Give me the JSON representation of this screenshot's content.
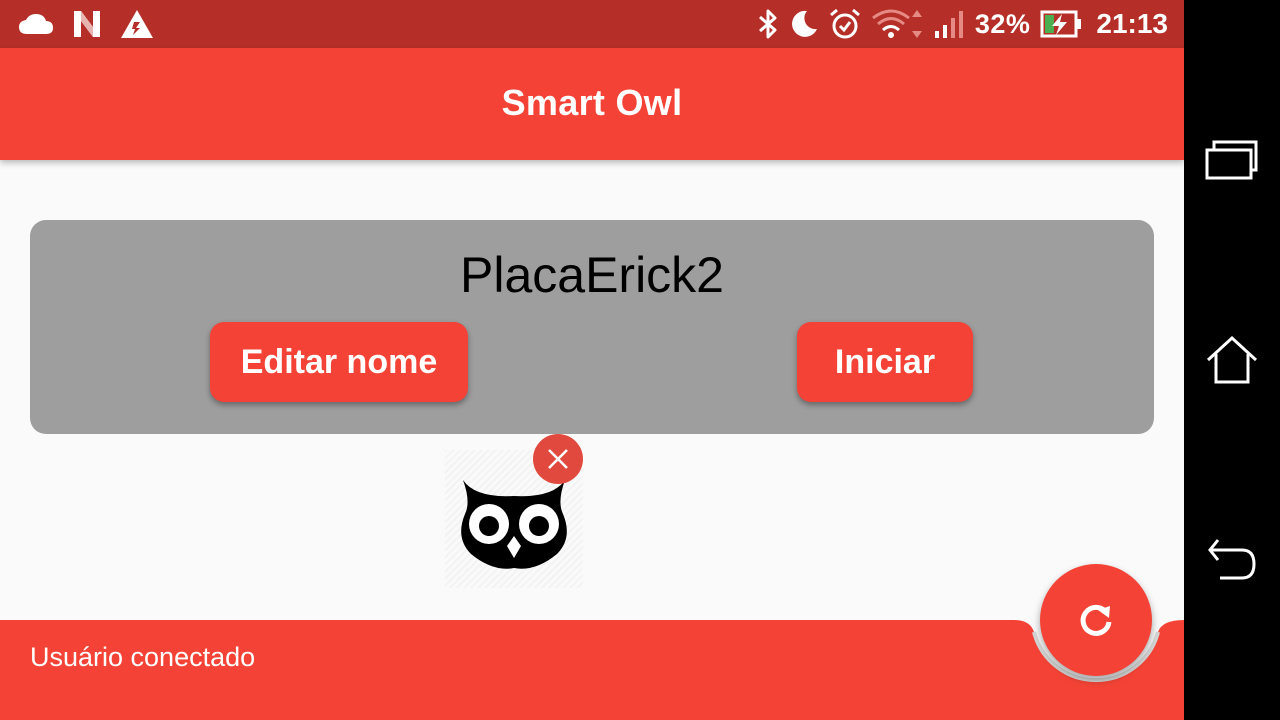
{
  "status_bar": {
    "notification_icons": [
      "cloud-icon",
      "n-app-icon",
      "warning-icon"
    ],
    "system_icons": [
      "bluetooth-icon",
      "moon-icon",
      "alarm-icon",
      "wifi-icon",
      "signal-icon"
    ],
    "battery_percent": "32%",
    "battery_level": 0.32,
    "time": "21:13"
  },
  "app_bar": {
    "title": "Smart Owl"
  },
  "device_card": {
    "name": "PlacaErick2",
    "edit_label": "Editar nome",
    "start_label": "Iniciar"
  },
  "owl_image": {
    "icon": "owl-icon"
  },
  "bottom_bar": {
    "status_text": "Usuário conectado"
  },
  "fab": {
    "icon": "refresh-icon"
  },
  "nav_bar": {
    "items": [
      "recents-icon",
      "home-icon",
      "back-icon"
    ]
  },
  "colors": {
    "status_bar": "#b52f28",
    "primary": "#f44336",
    "card": "#9e9e9e",
    "background": "#fafafa"
  }
}
